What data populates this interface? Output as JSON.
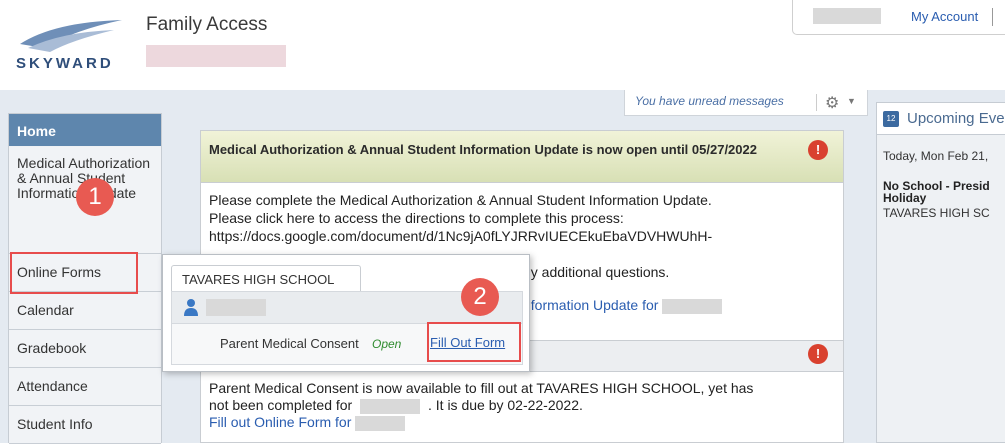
{
  "header": {
    "logo_text": "SKYWARD",
    "app_title": "Family Access",
    "my_account": "My Account"
  },
  "messages_bar": {
    "unread": "You have unread messages"
  },
  "sidebar": {
    "items": [
      {
        "label": "Home"
      },
      {
        "label": "Medical Authorization & Annual Student Information Update"
      },
      {
        "label": "Online Forms"
      },
      {
        "label": "Calendar"
      },
      {
        "label": "Gradebook"
      },
      {
        "label": "Attendance"
      },
      {
        "label": "Student Info"
      }
    ]
  },
  "callouts": {
    "one": "1",
    "two": "2"
  },
  "message1": {
    "title": "Medical Authorization & Annual Student Information Update is now open until 05/27/2022",
    "line1": "Please complete the Medical Authorization & Annual Student Information Update.",
    "line2": "Please click here to access the directions to complete this process:",
    "line3": "https://docs.google.com/document/d/1Nc9jA0fLYJRRvIUECEkuEbaVDVHWUhH-",
    "line4": "ny additional questions.",
    "link": "nformation Update for"
  },
  "message2": {
    "line1": "Parent Medical Consent is now available to fill out at TAVARES HIGH SCHOOL, yet has",
    "line2a": "not been completed for",
    "line2b": ". It is due by 02-22-2022.",
    "link": "Fill out Online Form for"
  },
  "popup": {
    "school": "TAVARES HIGH SCHOOL",
    "form_name": "Parent Medical Consent",
    "status": "Open",
    "action": "Fill Out Form"
  },
  "events": {
    "title": "Upcoming Events",
    "date": "Today, Mon Feb 21,",
    "event_title_l1": "No School - Presid",
    "event_title_l2": "Holiday",
    "school": "TAVARES HIGH SC"
  },
  "colors": {
    "accent": "#5e86ad",
    "link": "#2a5db0",
    "callout": "#e85a52",
    "open_status": "#2e8b2e"
  }
}
